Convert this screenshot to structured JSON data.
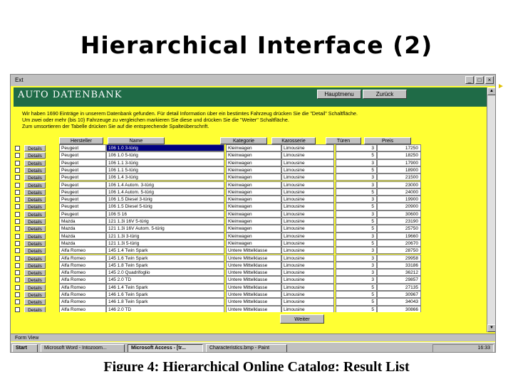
{
  "slide": {
    "title": "Hierarchical Interface (2)",
    "caption": "Figure 4: Hierarchical Online Catalog:  Result List"
  },
  "window": {
    "menu_label": "Ext",
    "app_title": "AUTO DATENBANK",
    "btn_hauptmenu": "Hauptmenu",
    "btn_zurueck": "Zurück",
    "ctl_minimize": "_",
    "ctl_maximize": "□",
    "ctl_close": "×",
    "info_lines": [
      "Wir haben   1690 Einträge in unserem Datenbank gefunden.     Für detail Information über ein bestimtes Fahrzeug drücken Sie die \"Detail\" Schaltfläche.",
      "Um zwei oder mehr (bis 10) Fahrzeuge zu vergleichen markieren Sie diese und drücken Sie die \"Weiter\" Schaltfläche.",
      "Zum umsortieren der Tabelle drücken Sie auf die entsprechende Spalteüberschrift."
    ],
    "columns": {
      "hersteller": "Hersteller",
      "name": "Name",
      "kategorie": "Kategorie",
      "karosserie": "Karosserie",
      "tueren": "Türen",
      "preis": "Preis"
    },
    "details_label": "Details",
    "rows": [
      {
        "hersteller": "Peugeot",
        "name": "106 1.0 3-türig",
        "kategorie": "Kleinwagen",
        "karosserie": "Limousine",
        "tueren": "3",
        "preis": "17250"
      },
      {
        "hersteller": "Peugeot",
        "name": "106 1.0 5-türig",
        "kategorie": "Kleinwagen",
        "karosserie": "Limousine",
        "tueren": "5",
        "preis": "18250"
      },
      {
        "hersteller": "Peugeot",
        "name": "106 1.1 3-türig",
        "kategorie": "Kleinwagen",
        "karosserie": "Limousine",
        "tueren": "3",
        "preis": "17900"
      },
      {
        "hersteller": "Peugeot",
        "name": "106 1.1 5-türig",
        "kategorie": "Kleinwagen",
        "karosserie": "Limousine",
        "tueren": "5",
        "preis": "18900"
      },
      {
        "hersteller": "Peugeot",
        "name": "106 1.4 3-türig",
        "kategorie": "Kleinwagen",
        "karosserie": "Limousine",
        "tueren": "3",
        "preis": "21500"
      },
      {
        "hersteller": "Peugeot",
        "name": "106 1.4 Autom. 3-türig",
        "kategorie": "Kleinwagen",
        "karosserie": "Limousine",
        "tueren": "3",
        "preis": "23000"
      },
      {
        "hersteller": "Peugeot",
        "name": "106 1.4 Autom. 5-türig",
        "kategorie": "Kleinwagen",
        "karosserie": "Limousine",
        "tueren": "5",
        "preis": "24000"
      },
      {
        "hersteller": "Peugeot",
        "name": "106 1.5 Diesel 3-türig",
        "kategorie": "Kleinwagen",
        "karosserie": "Limousine",
        "tueren": "3",
        "preis": "19900"
      },
      {
        "hersteller": "Peugeot",
        "name": "106 1.5 Diesel 5-türig",
        "kategorie": "Kleinwagen",
        "karosserie": "Limousine",
        "tueren": "5",
        "preis": "20900"
      },
      {
        "hersteller": "Peugeot",
        "name": "106 S 16",
        "kategorie": "Kleinwagen",
        "karosserie": "Limousine",
        "tueren": "3",
        "preis": "30600"
      },
      {
        "hersteller": "Mazda",
        "name": "121 1.3i 16V 5-türig",
        "kategorie": "Kleinwagen",
        "karosserie": "Limousine",
        "tueren": "5",
        "preis": "23190"
      },
      {
        "hersteller": "Mazda",
        "name": "121 1.3i 16V Autom. 5-türig",
        "kategorie": "Kleinwagen",
        "karosserie": "Limousine",
        "tueren": "5",
        "preis": "25750"
      },
      {
        "hersteller": "Mazda",
        "name": "121 1.3i 3-türig",
        "kategorie": "Kleinwagen",
        "karosserie": "Limousine",
        "tueren": "3",
        "preis": "19660"
      },
      {
        "hersteller": "Mazda",
        "name": "121 1.3i 5-türig",
        "kategorie": "Kleinwagen",
        "karosserie": "Limousine",
        "tueren": "5",
        "preis": "20670"
      },
      {
        "hersteller": "Alfa Romeo",
        "name": "145 1.4 Twin Spark",
        "kategorie": "Untere Mittelklasse",
        "karosserie": "Limousine",
        "tueren": "3",
        "preis": "28750"
      },
      {
        "hersteller": "Alfa Romeo",
        "name": "145 1.6 Twin Spark",
        "kategorie": "Untere Mittelklasse",
        "karosserie": "Limousine",
        "tueren": "3",
        "preis": "29958"
      },
      {
        "hersteller": "Alfa Romeo",
        "name": "145 1.8 Twin Spark",
        "kategorie": "Untere Mittelklasse",
        "karosserie": "Limousine",
        "tueren": "3",
        "preis": "33186"
      },
      {
        "hersteller": "Alfa Romeo",
        "name": "145 2.0 Quadrifoglio",
        "kategorie": "Untere Mittelklasse",
        "karosserie": "Limousine",
        "tueren": "3",
        "preis": "36212"
      },
      {
        "hersteller": "Alfa Romeo",
        "name": "145 2.0 TD",
        "kategorie": "Untere Mittelklasse",
        "karosserie": "Limousine",
        "tueren": "3",
        "preis": "29857"
      },
      {
        "hersteller": "Alfa Romeo",
        "name": "146 1.4 Twin Spark",
        "kategorie": "Untere Mittelklasse",
        "karosserie": "Limousine",
        "tueren": "5",
        "preis": "27135"
      },
      {
        "hersteller": "Alfa Romeo",
        "name": "146 1.6 Twin Spark",
        "kategorie": "Untere Mittelklasse",
        "karosserie": "Limousine",
        "tueren": "5",
        "preis": "30967"
      },
      {
        "hersteller": "Alfa Romeo",
        "name": "146 1.8 Twin Spark",
        "kategorie": "Untere Mittelklasse",
        "karosserie": "Limousine",
        "tueren": "5",
        "preis": "34043"
      },
      {
        "hersteller": "Alfa Romeo",
        "name": "146 2.0 TD",
        "kategorie": "Untere Mittelklasse",
        "karosserie": "Limousine",
        "tueren": "5",
        "preis": "30866"
      }
    ],
    "btn_weiter": "Weiter",
    "status_text": "Form View"
  },
  "taskbar": {
    "start_label": "Start",
    "tasks": [
      "Microsoft Word - Intozoom...",
      "Microsoft Access - [tr...",
      "Characteristics.bmp - Paint"
    ],
    "clock": "16:33"
  },
  "colors": {
    "window_bg": "#ffff33",
    "header_bg": "#1f6b47",
    "selected_cell": "#000080"
  }
}
